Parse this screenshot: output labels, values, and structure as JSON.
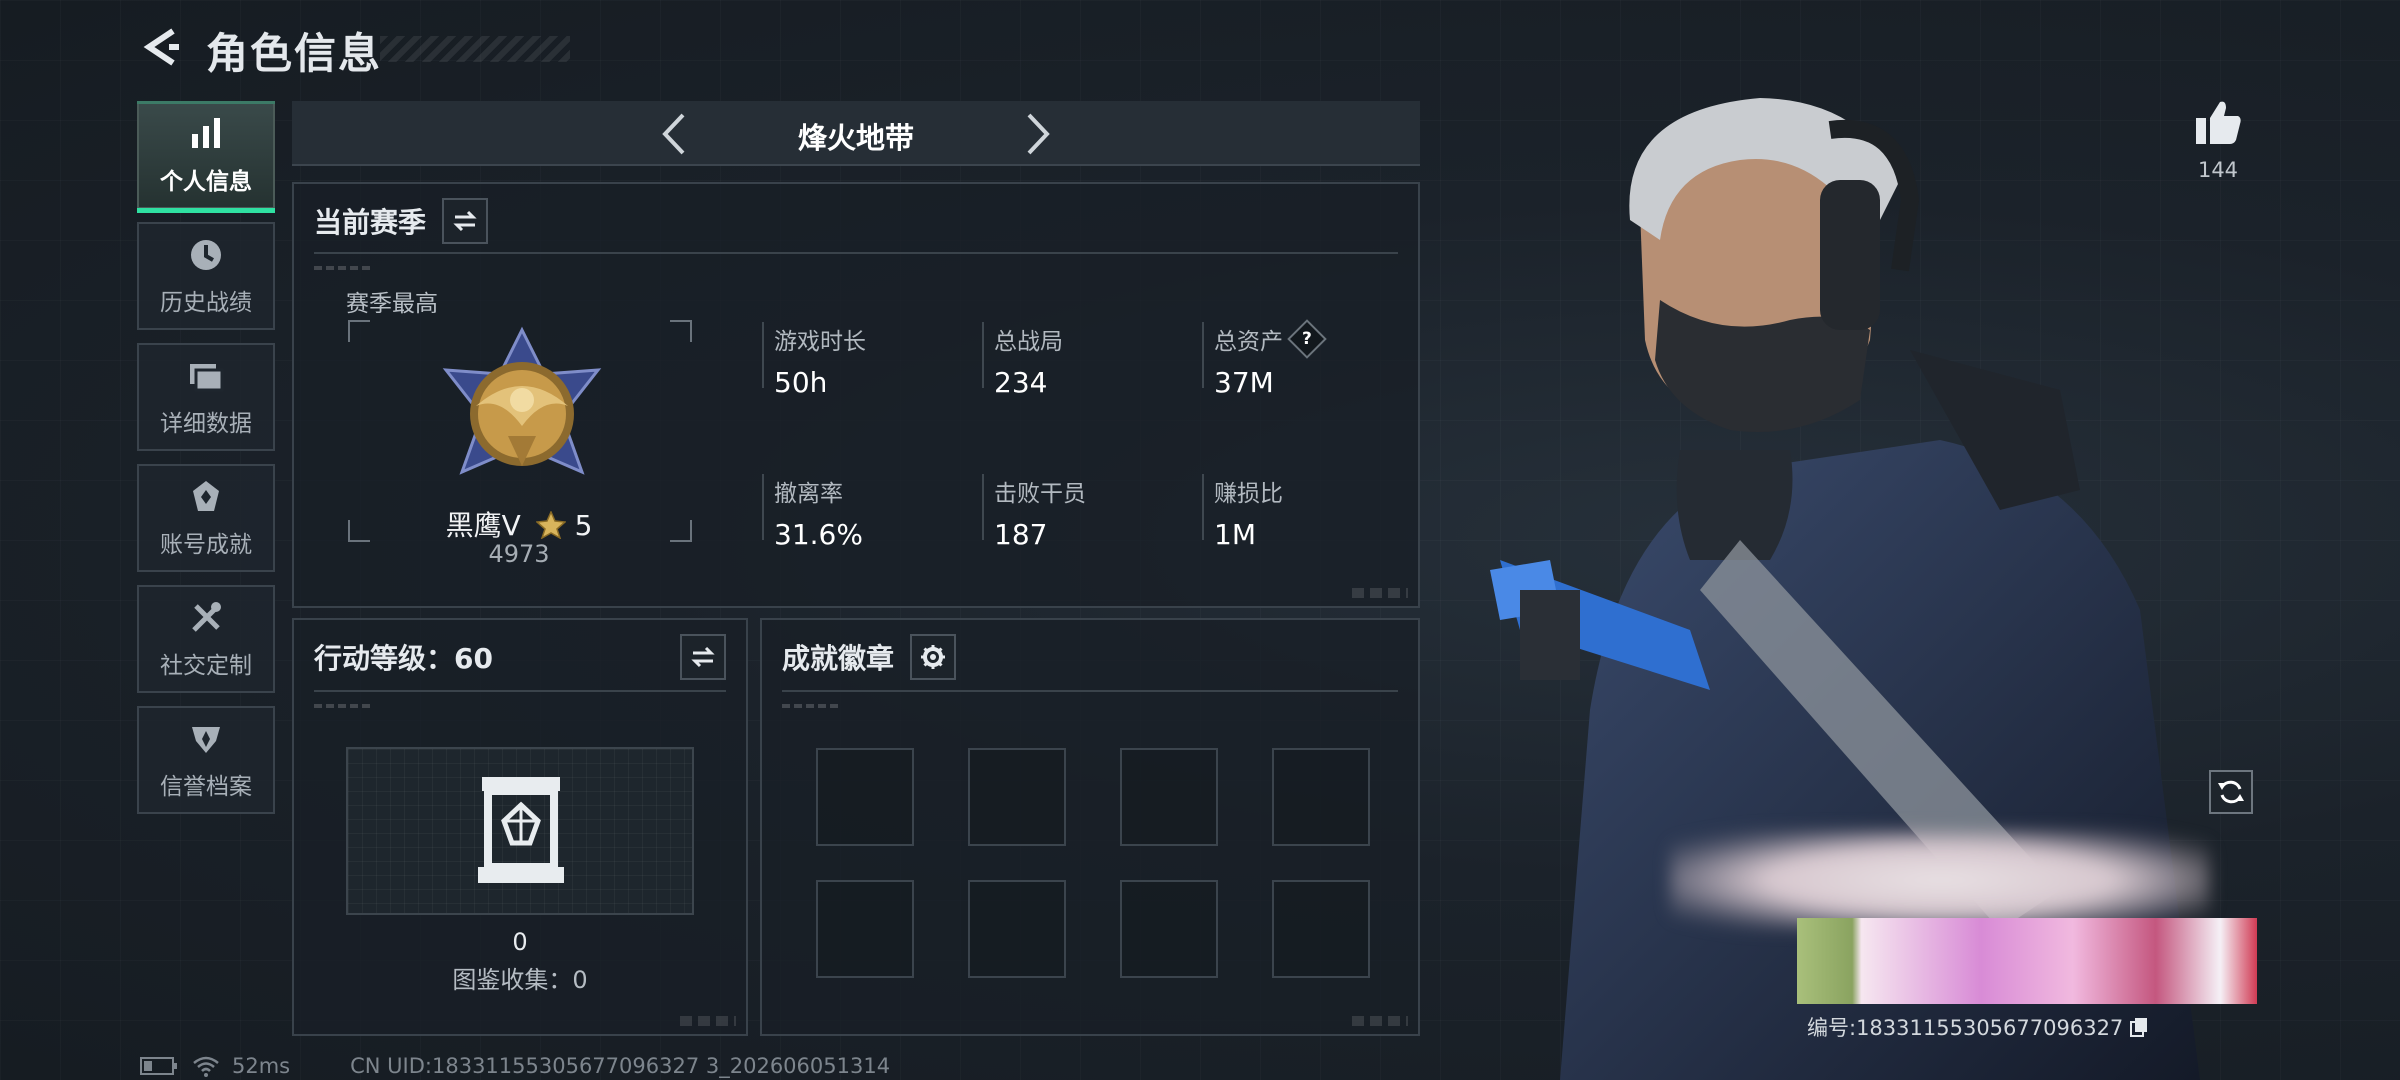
{
  "header": {
    "title": "角色信息"
  },
  "sidebar": {
    "items": [
      {
        "label": "个人信息",
        "icon": "bar-chart-icon",
        "active": true
      },
      {
        "label": "历史战绩",
        "icon": "clock-icon",
        "active": false
      },
      {
        "label": "详细数据",
        "icon": "folder-icon",
        "active": false
      },
      {
        "label": "账号成就",
        "icon": "achievement-icon",
        "active": false
      },
      {
        "label": "社交定制",
        "icon": "tools-icon",
        "active": false
      },
      {
        "label": "信誉档案",
        "icon": "reputation-icon",
        "active": false
      }
    ]
  },
  "mode_selector": {
    "name": "烽火地带"
  },
  "season": {
    "title": "当前赛季",
    "subtitle": "赛季最高",
    "rank_name": "黑鹰Ⅴ",
    "rank_stars": "5",
    "rank_score": "4973",
    "stats": [
      {
        "label": "游戏时长",
        "value": "50h"
      },
      {
        "label": "总战局",
        "value": "234"
      },
      {
        "label": "总资产",
        "value": "37M",
        "help": "?"
      },
      {
        "label": "撤离率",
        "value": "31.6%"
      },
      {
        "label": "击败干员",
        "value": "187"
      },
      {
        "label": "赚损比",
        "value": "1M"
      }
    ]
  },
  "action_level": {
    "title": "行动等级：60",
    "collect_value": "0",
    "collect_label": "图鉴收集：0"
  },
  "achievements": {
    "title": "成就徽章",
    "slots": 8
  },
  "right": {
    "likes": "144",
    "card_id": "编号:18331155305677096327"
  },
  "footer": {
    "ping": "52ms",
    "uid": "CN UID:18331155305677096327 3_202606051314"
  },
  "colors": {
    "accent": "#2fe1a2",
    "background": "#1b222a",
    "panel_border": "#39424b"
  }
}
